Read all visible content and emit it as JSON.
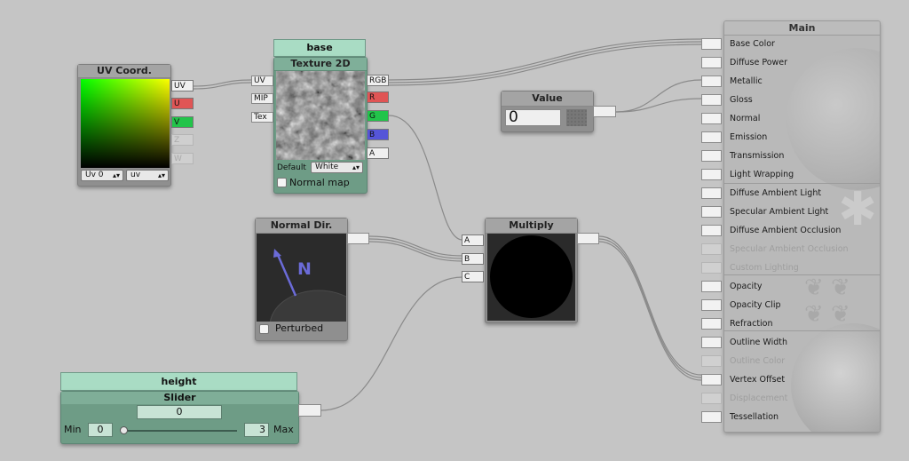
{
  "colors": {
    "background": "#c5c5c5",
    "node": "#8f8f8f",
    "slider_node": "#6e9c86",
    "slider_header": "#a9dcc4",
    "port_u": "#e05555",
    "port_v": "#22c44a",
    "port_r": "#e05555",
    "port_g": "#22c44a",
    "port_b": "#5555d8"
  },
  "uv_node": {
    "title": "UV Coord.",
    "out_ports": [
      "UV",
      "U",
      "V",
      "Z",
      "W"
    ],
    "uv_channel_select": "Uv 0",
    "uv_type_select": "uv"
  },
  "texture_node": {
    "header": "base",
    "title": "Texture 2D",
    "in_ports": [
      "UV",
      "MIP",
      "Tex"
    ],
    "out_ports": [
      "RGB",
      "R",
      "G",
      "B",
      "A"
    ],
    "default_label": "Default",
    "default_select": "White",
    "normal_map_label": "Normal map"
  },
  "value_node": {
    "title": "Value",
    "value": "0"
  },
  "normal_node": {
    "title": "Normal Dir.",
    "preview_letter": "N",
    "perturbed_label": "Perturbed"
  },
  "multiply_node": {
    "title": "Multiply",
    "in_ports": [
      "A",
      "B",
      "C"
    ]
  },
  "slider_node": {
    "header": "height",
    "title": "Slider",
    "value": "0",
    "min_label": "Min",
    "min_value": "0",
    "max_label": "Max",
    "max_value": "3",
    "slider_fraction": 0
  },
  "main_node": {
    "title": "Main",
    "inputs": [
      {
        "label": "Base Color",
        "enabled": true
      },
      {
        "label": "Diffuse Power",
        "enabled": true
      },
      {
        "label": "Metallic",
        "enabled": true
      },
      {
        "label": "Gloss",
        "enabled": true
      },
      {
        "label": "Normal",
        "enabled": true
      },
      {
        "label": "Emission",
        "enabled": true
      },
      {
        "label": "Transmission",
        "enabled": true
      },
      {
        "label": "Light Wrapping",
        "enabled": true
      },
      {
        "label": "Diffuse Ambient Light",
        "enabled": true
      },
      {
        "label": "Specular Ambient Light",
        "enabled": true
      },
      {
        "label": "Diffuse Ambient Occlusion",
        "enabled": true
      },
      {
        "label": "Specular Ambient Occlusion",
        "enabled": false
      },
      {
        "label": "Custom Lighting",
        "enabled": false
      },
      {
        "label": "Opacity",
        "enabled": true
      },
      {
        "label": "Opacity Clip",
        "enabled": true
      },
      {
        "label": "Refraction",
        "enabled": true
      },
      {
        "label": "Outline Width",
        "enabled": true
      },
      {
        "label": "Outline Color",
        "enabled": false
      },
      {
        "label": "Vertex Offset",
        "enabled": true
      },
      {
        "label": "Displacement",
        "enabled": false
      },
      {
        "label": "Tessellation",
        "enabled": true
      }
    ]
  }
}
